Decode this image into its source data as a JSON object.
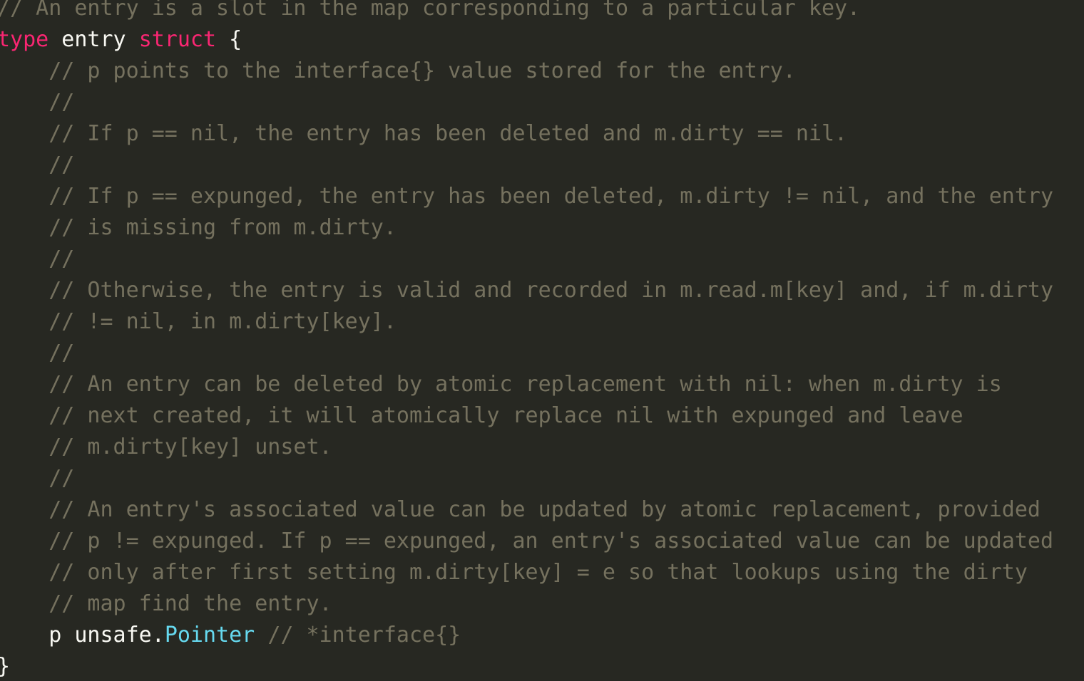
{
  "theme": {
    "background": "#272822",
    "foreground": "#f8f8f2",
    "comment": "#75715e",
    "keyword": "#f92672",
    "type": "#66d9ef"
  },
  "editor": {
    "language": "go",
    "lines": [
      {
        "indent": 0,
        "tokens": [
          {
            "kind": "comment",
            "text": "// An entry is a slot in the map corresponding to a particular key."
          }
        ]
      },
      {
        "indent": 0,
        "tokens": [
          {
            "kind": "keyword",
            "text": "type"
          },
          {
            "kind": "plain",
            "text": " entry "
          },
          {
            "kind": "keyword",
            "text": "struct"
          },
          {
            "kind": "plain",
            "text": " {"
          }
        ]
      },
      {
        "indent": 1,
        "tokens": [
          {
            "kind": "comment",
            "text": "// p points to the interface{} value stored for the entry."
          }
        ]
      },
      {
        "indent": 1,
        "tokens": [
          {
            "kind": "comment",
            "text": "//"
          }
        ]
      },
      {
        "indent": 1,
        "tokens": [
          {
            "kind": "comment",
            "text": "// If p == nil, the entry has been deleted and m.dirty == nil."
          }
        ]
      },
      {
        "indent": 1,
        "tokens": [
          {
            "kind": "comment",
            "text": "//"
          }
        ]
      },
      {
        "indent": 1,
        "tokens": [
          {
            "kind": "comment",
            "text": "// If p == expunged, the entry has been deleted, m.dirty != nil, and the entry"
          }
        ]
      },
      {
        "indent": 1,
        "tokens": [
          {
            "kind": "comment",
            "text": "// is missing from m.dirty."
          }
        ]
      },
      {
        "indent": 1,
        "tokens": [
          {
            "kind": "comment",
            "text": "//"
          }
        ]
      },
      {
        "indent": 1,
        "tokens": [
          {
            "kind": "comment",
            "text": "// Otherwise, the entry is valid and recorded in m.read.m[key] and, if m.dirty"
          }
        ]
      },
      {
        "indent": 1,
        "tokens": [
          {
            "kind": "comment",
            "text": "// != nil, in m.dirty[key]."
          }
        ]
      },
      {
        "indent": 1,
        "tokens": [
          {
            "kind": "comment",
            "text": "//"
          }
        ]
      },
      {
        "indent": 1,
        "tokens": [
          {
            "kind": "comment",
            "text": "// An entry can be deleted by atomic replacement with nil: when m.dirty is"
          }
        ]
      },
      {
        "indent": 1,
        "tokens": [
          {
            "kind": "comment",
            "text": "// next created, it will atomically replace nil with expunged and leave"
          }
        ]
      },
      {
        "indent": 1,
        "tokens": [
          {
            "kind": "comment",
            "text": "// m.dirty[key] unset."
          }
        ]
      },
      {
        "indent": 1,
        "tokens": [
          {
            "kind": "comment",
            "text": "//"
          }
        ]
      },
      {
        "indent": 1,
        "tokens": [
          {
            "kind": "comment",
            "text": "// An entry's associated value can be updated by atomic replacement, provided"
          }
        ]
      },
      {
        "indent": 1,
        "tokens": [
          {
            "kind": "comment",
            "text": "// p != expunged. If p == expunged, an entry's associated value can be updated"
          }
        ]
      },
      {
        "indent": 1,
        "tokens": [
          {
            "kind": "comment",
            "text": "// only after first setting m.dirty[key] = e so that lookups using the dirty"
          }
        ]
      },
      {
        "indent": 1,
        "tokens": [
          {
            "kind": "comment",
            "text": "// map find the entry."
          }
        ]
      },
      {
        "indent": 1,
        "tokens": [
          {
            "kind": "plain",
            "text": "p unsafe."
          },
          {
            "kind": "type",
            "text": "Pointer"
          },
          {
            "kind": "plain",
            "text": " "
          },
          {
            "kind": "comment",
            "text": "// *interface{}"
          }
        ]
      },
      {
        "indent": 0,
        "tokens": [
          {
            "kind": "plain",
            "text": "}"
          }
        ]
      }
    ]
  }
}
